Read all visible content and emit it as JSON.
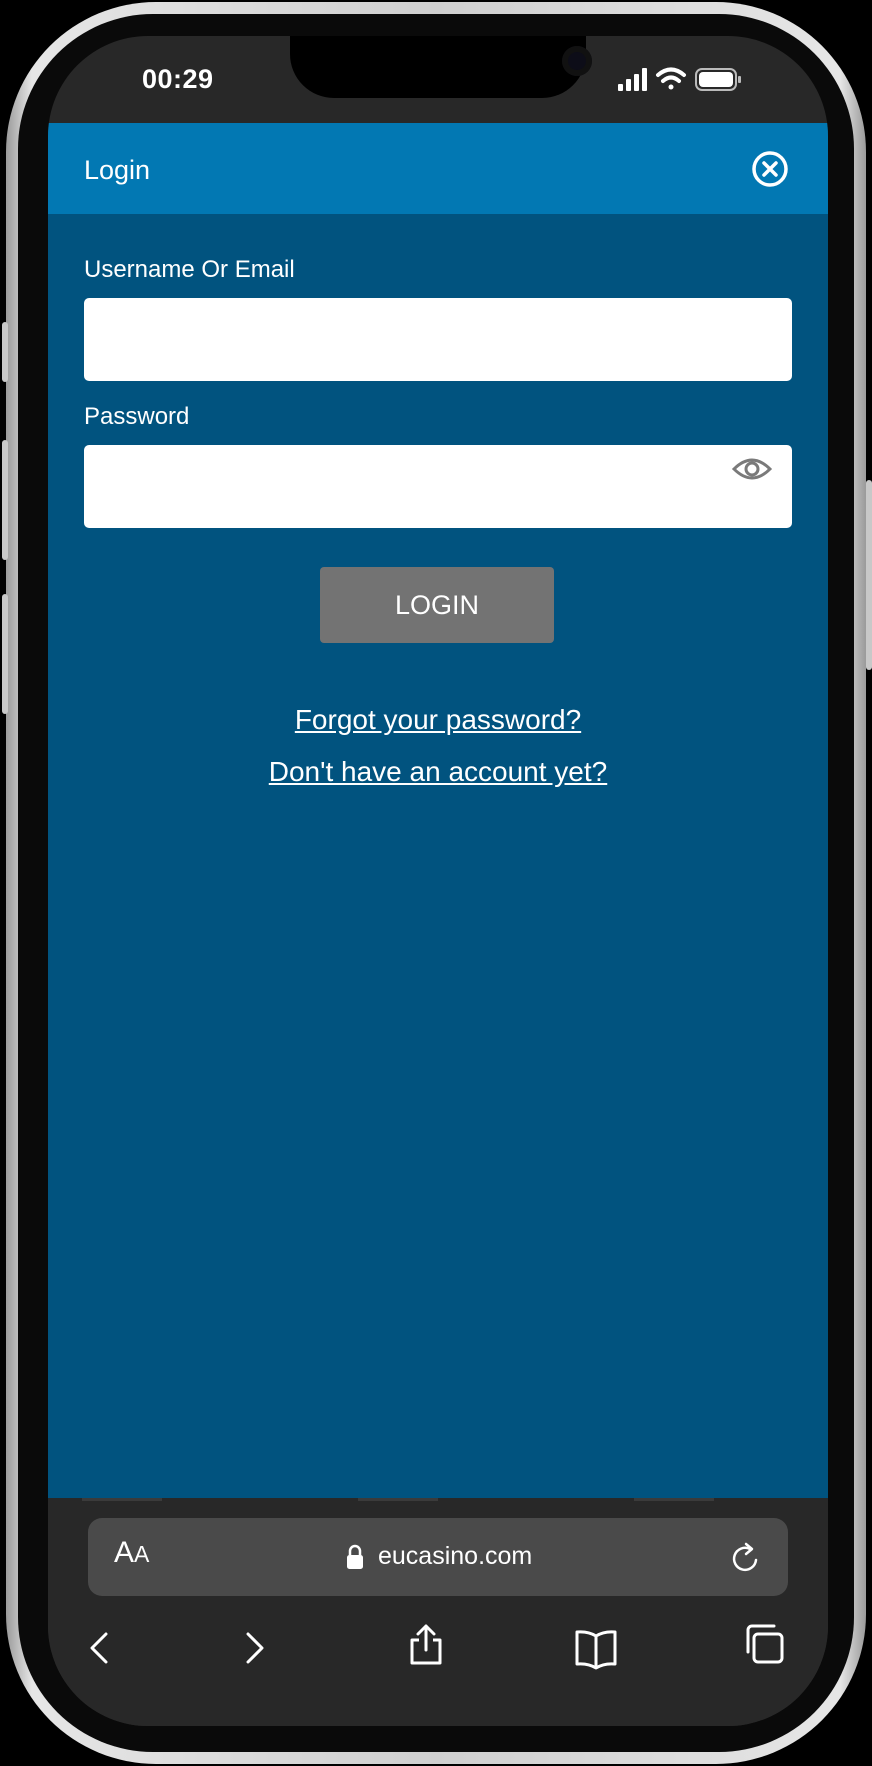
{
  "status_bar": {
    "time": "00:29"
  },
  "modal": {
    "title": "Login",
    "username_label": "Username Or Email",
    "username_value": "",
    "password_label": "Password",
    "password_value": "",
    "login_button": "LOGIN",
    "forgot_link": "Forgot your password?",
    "signup_link": "Don't have an account yet?"
  },
  "browser": {
    "aa_big": "A",
    "aa_small": "A",
    "url": "eucasino.com"
  },
  "colors": {
    "header_bg": "#0278b3",
    "content_bg": "#01537f",
    "button_bg": "#737373",
    "browser_bg": "#282828",
    "urlbar_bg": "#4a4a4a"
  },
  "icons": [
    "close-circle-icon",
    "eye-icon",
    "lock-icon",
    "reload-icon",
    "back-icon",
    "forward-icon",
    "share-icon",
    "bookmarks-icon",
    "tabs-icon",
    "signal-icon",
    "wifi-icon",
    "battery-icon"
  ]
}
